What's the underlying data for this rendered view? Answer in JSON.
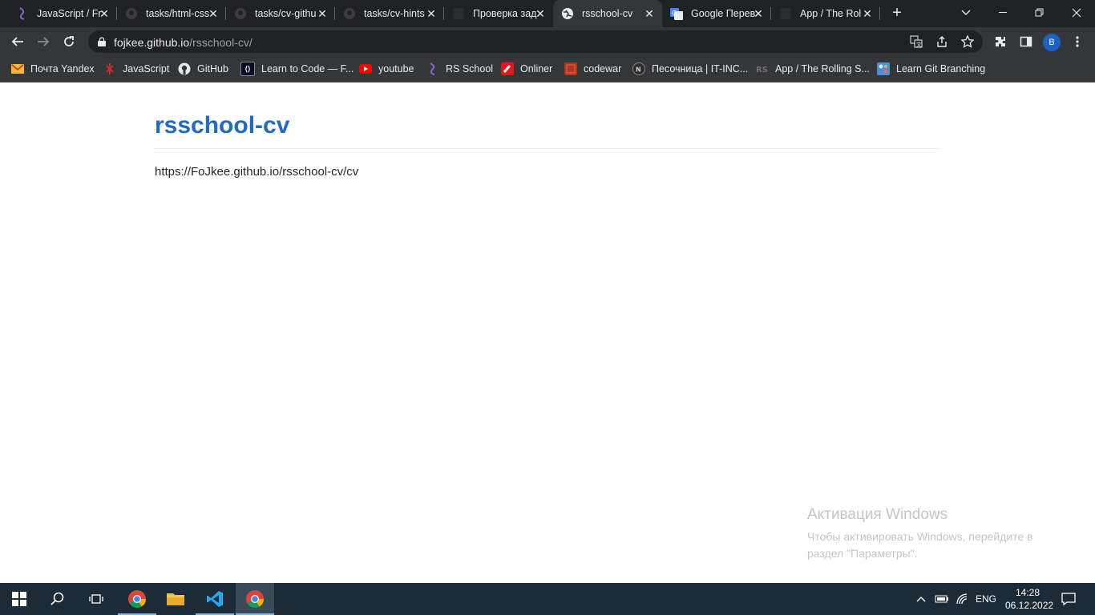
{
  "browser": {
    "tabs": [
      {
        "title": "JavaScript / Fr",
        "icon": "rs-school-icon",
        "active": false
      },
      {
        "title": "tasks/html-css",
        "icon": "github-icon",
        "active": false
      },
      {
        "title": "tasks/cv-githu",
        "icon": "github-icon",
        "active": false
      },
      {
        "title": "tasks/cv-hints",
        "icon": "github-icon",
        "active": false
      },
      {
        "title": "Проверка зад",
        "icon": "blank-icon",
        "active": false
      },
      {
        "title": "rsschool-cv",
        "icon": "globe-icon",
        "active": true
      },
      {
        "title": "Google Перев",
        "icon": "google-translate-icon",
        "active": false
      },
      {
        "title": "App / The Rol",
        "icon": "rs-app-icon",
        "active": false
      }
    ],
    "close_glyph": "✕",
    "new_tab_glyph": "+",
    "address": {
      "host": "fojkee.github.io",
      "path": "/rsschool-cv/"
    },
    "profile_initial": "B",
    "bookmarks": [
      {
        "label": "Почта Yandex",
        "icon": "mail-icon",
        "color": "#f5b82e"
      },
      {
        "label": "JavaScript",
        "icon": "javascript-icon",
        "color": "#c62f2f"
      },
      {
        "label": "GitHub",
        "icon": "github-icon",
        "color": "#ffffff"
      },
      {
        "label": "Learn to Code — F...",
        "icon": "freecodecamp-icon",
        "color": "#0a0a23"
      },
      {
        "label": "youtube",
        "icon": "youtube-icon",
        "color": "#ff0000"
      },
      {
        "label": "RS School",
        "icon": "rs-school-icon",
        "color": "#8a63d2"
      },
      {
        "label": "Onliner",
        "icon": "onliner-icon",
        "color": "#e4161b"
      },
      {
        "label": "codewar",
        "icon": "codewars-icon",
        "color": "#b1361e"
      },
      {
        "label": "Песочница | IT-INC...",
        "icon": "it-inc-icon",
        "color": "#2b2b2b"
      },
      {
        "label": "App / The Rolling S...",
        "icon": "rs-app-icon",
        "color": "#3a3a3a"
      },
      {
        "label": "Learn Git Branching",
        "icon": "git-branching-icon",
        "color": "#4b8fd6"
      }
    ]
  },
  "page": {
    "title": "rsschool-cv",
    "link_text": "https://FoJkee.github.io/rsschool-cv/cv"
  },
  "activation": {
    "heading": "Активация Windows",
    "body": "Чтобы активировать Windows, перейдите в раздел \"Параметры\"."
  },
  "taskbar": {
    "language": "ENG",
    "time": "14:28",
    "date": "06.12.2022"
  },
  "colors": {
    "accent_link": "#1f69c9",
    "tab_bar": "#202124",
    "toolbar": "#35363a",
    "taskbar": "#1c2b36"
  }
}
